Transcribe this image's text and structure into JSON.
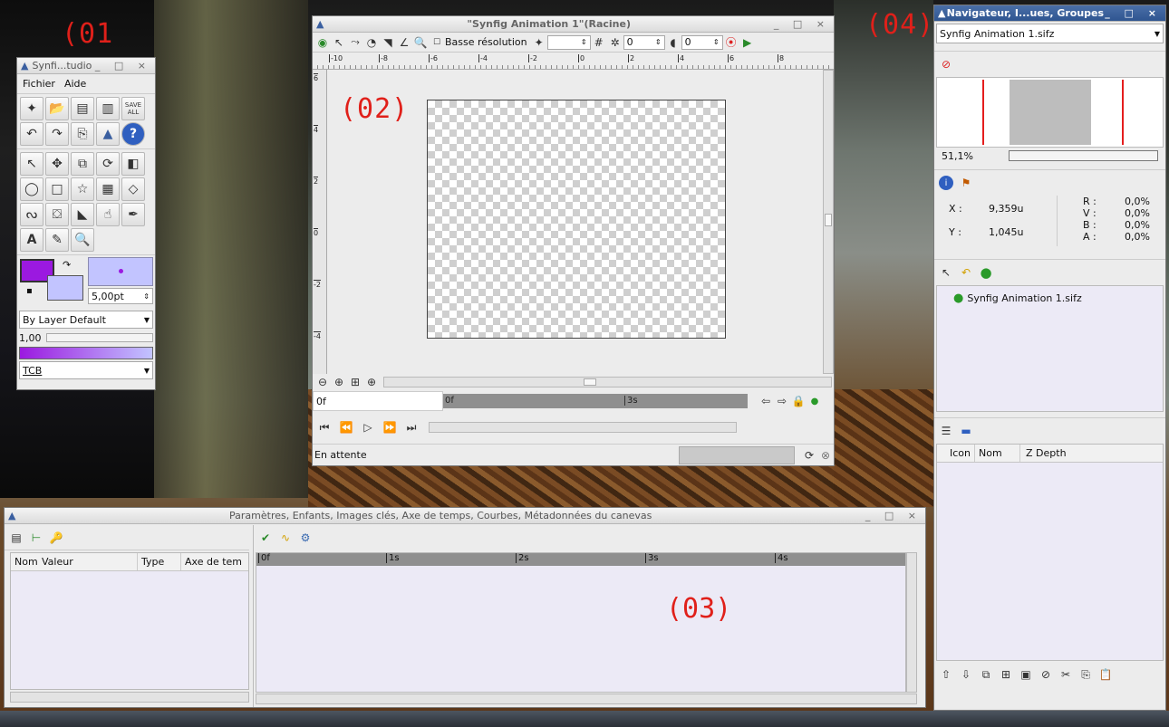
{
  "annotations": [
    "(01",
    "(02)",
    "(03)",
    "(04)"
  ],
  "toolbox": {
    "title": "Synfi...tudio",
    "menu": [
      "Fichier",
      "Aide"
    ],
    "save_all_label": "SAVE ALL",
    "brush_size": "5,00pt",
    "blend_method": "By Layer Default",
    "opacity": "1,00",
    "interpolation": "TCB",
    "outline_color": "#9b19e0",
    "fill_color": "#c2c4ff"
  },
  "canvas_window": {
    "title": "\"Synfig Animation 1\"(Racine)",
    "low_res_label": "Basse résolution",
    "spin_value_1": "0",
    "spin_value_2": "0",
    "ruler_h_labels": [
      "-10",
      "-8",
      "-6",
      "-4",
      "-2",
      "0",
      "2",
      "4",
      "6",
      "8"
    ],
    "ruler_v_labels": [
      "6",
      "4",
      "2",
      "0",
      "-2",
      "-4"
    ],
    "current_time": "0f",
    "timebar_labels": [
      "0f",
      "3s"
    ],
    "status": "En attente"
  },
  "params_panel": {
    "title": "Paramètres, Enfants, Images clés, Axe de temps, Courbes, Métadonnées du canevas",
    "columns": [
      "Nom",
      "Valeur",
      "Type",
      "Axe de tem"
    ],
    "timeline_labels": [
      "0f",
      "1s",
      "2s",
      "3s",
      "4s"
    ]
  },
  "navigator": {
    "title": "Navigateur, I...ues, Groupes",
    "file_selector": "Synfig Animation 1.sifz",
    "zoom": "51,1%",
    "info": {
      "x_label": "X :",
      "x_value": "9,359u",
      "y_label": "Y :",
      "y_value": "1,045u",
      "r_label": "R :",
      "r_value": "0,0%",
      "v_label": "V :",
      "v_value": "0,0%",
      "b_label": "B :",
      "b_value": "0,0%",
      "a_label": "A :",
      "a_value": "0,0%"
    },
    "canvas_item": "Synfig Animation 1.sifz",
    "layer_columns": [
      "Icon",
      "Nom",
      "Z Depth"
    ]
  }
}
